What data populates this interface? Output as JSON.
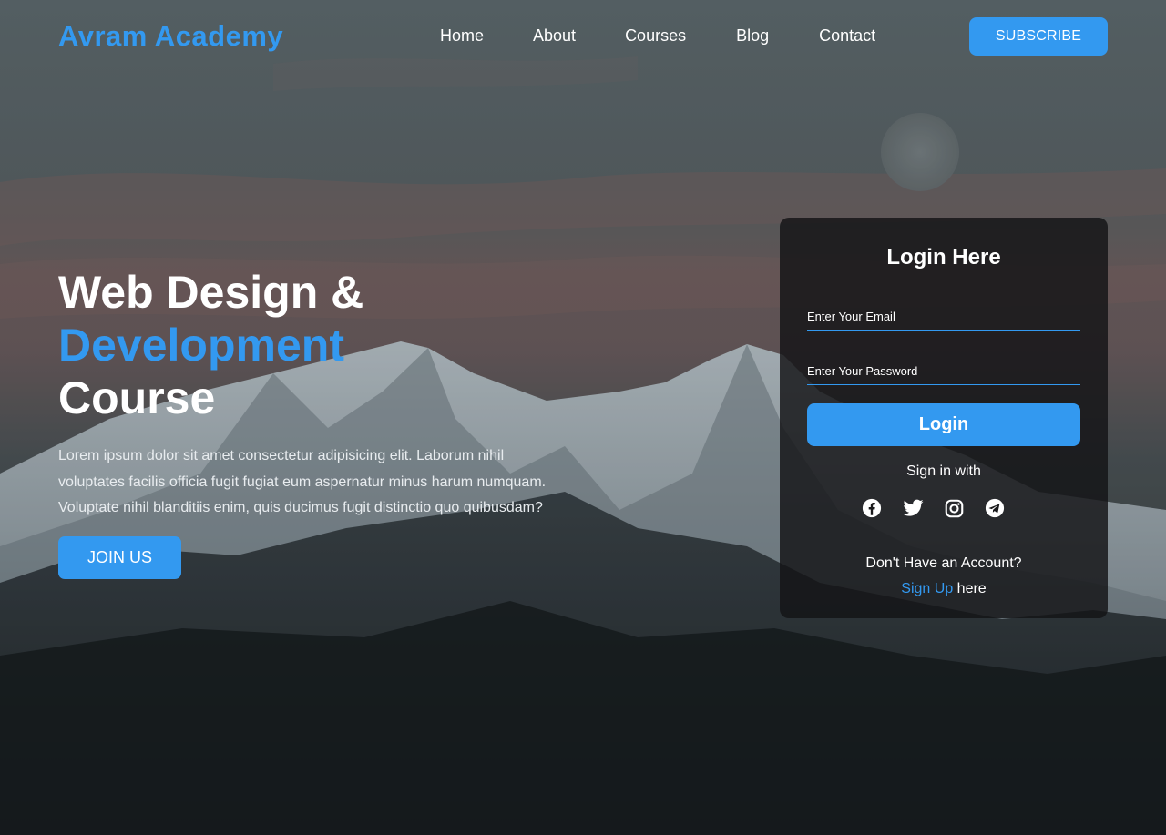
{
  "brand": {
    "name": "Avram Academy",
    "accent_color": "#3399f0"
  },
  "nav": {
    "items": [
      {
        "label": "Home"
      },
      {
        "label": "About"
      },
      {
        "label": "Courses"
      },
      {
        "label": "Blog"
      },
      {
        "label": "Contact"
      }
    ],
    "subscribe_label": "SUBSCRIBE"
  },
  "hero": {
    "title_line1": "Web Design &",
    "title_line2": "Development",
    "title_line3": "Course",
    "paragraph": "Lorem ipsum dolor sit amet consectetur adipisicing elit. Laborum nihil voluptates facilis officia fugit fugiat eum aspernatur minus harum numquam. Voluptate nihil blanditiis enim, quis ducimus fugit distinctio quo quibusdam?",
    "join_label": "JOIN US"
  },
  "login": {
    "title": "Login Here",
    "email_placeholder": "Enter Your Email",
    "email_value": "",
    "password_placeholder": "Enter Your Password",
    "password_value": "",
    "login_label": "Login",
    "signin_with": "Sign in with",
    "socials": [
      {
        "icon": "facebook-icon"
      },
      {
        "icon": "twitter-icon"
      },
      {
        "icon": "instagram-icon"
      },
      {
        "icon": "telegram-icon"
      }
    ],
    "no_account": "Don't Have an Account?",
    "signup_link": "Sign Up",
    "signup_suffix": " here"
  }
}
